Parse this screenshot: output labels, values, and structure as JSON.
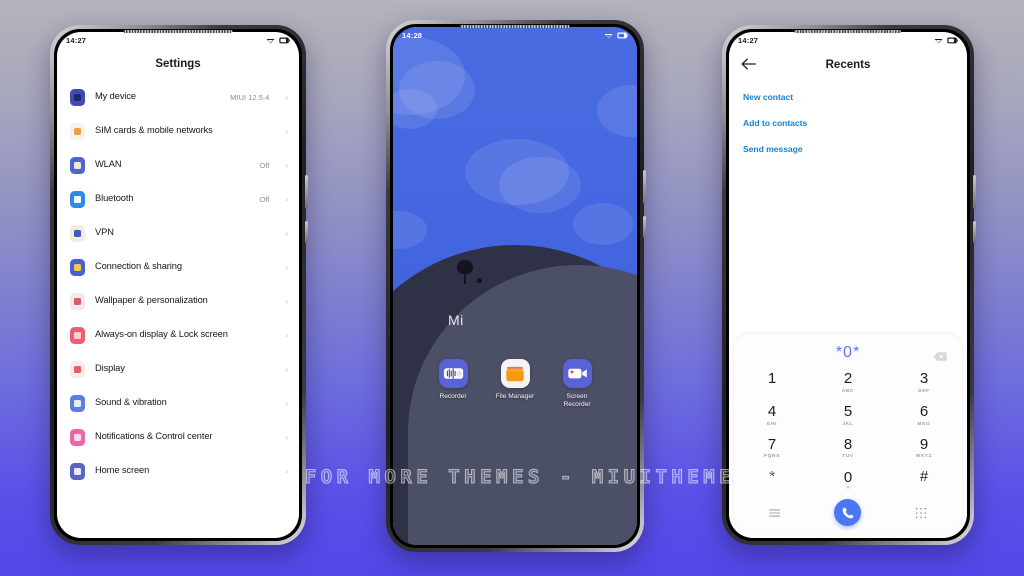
{
  "background": {
    "top_color": "#b4b4bc",
    "bottom_color": "#5347ea"
  },
  "watermark": {
    "text": "VISIT  FOR  MORE  THEMES  -  MIUITHEMER.COM"
  },
  "phone_settings": {
    "status_bar": {
      "time": "14:27",
      "wifi_icon": "wifi-icon",
      "battery_icon": "battery-icon"
    },
    "title": "Settings",
    "items": [
      {
        "label": "My device",
        "value": "MIUI 12.5.4",
        "chevron": "›",
        "icon": "device-icon",
        "icon_bg": "#3f4bb8",
        "icon_glyph": "#1b2a66"
      },
      {
        "label": "SIM cards & mobile networks",
        "value": "",
        "chevron": "›",
        "icon": "sim-card-icon",
        "icon_bg": "#f4f2ee",
        "icon_glyph": "#e8a33d"
      },
      {
        "label": "WLAN",
        "value": "Off",
        "chevron": "›",
        "icon": "wifi-settings-icon",
        "icon_bg": "#4e63d8",
        "icon_glyph": "#f2e9c6"
      },
      {
        "label": "Bluetooth",
        "value": "Off",
        "chevron": "›",
        "icon": "bluetooth-icon",
        "icon_bg": "#2e8ae6",
        "icon_glyph": "#ffffff"
      },
      {
        "label": "VPN",
        "value": "",
        "chevron": "›",
        "icon": "vpn-icon",
        "icon_bg": "#f0ece2",
        "icon_glyph": "#3f5bbf"
      },
      {
        "label": "Connection & sharing",
        "value": "",
        "chevron": "›",
        "icon": "connection-icon",
        "icon_bg": "#4a5fd6",
        "icon_glyph": "#f3c84a"
      },
      {
        "label": "Wallpaper & personalization",
        "value": "",
        "chevron": "›",
        "icon": "wallpaper-icon",
        "icon_bg": "#f2eaea",
        "icon_glyph": "#e0566f"
      },
      {
        "label": "Always-on display & Lock screen",
        "value": "",
        "chevron": "›",
        "icon": "lock-screen-icon",
        "icon_bg": "#ef5d72",
        "icon_glyph": "#ffd2d8"
      },
      {
        "label": "Display",
        "value": "",
        "chevron": "›",
        "icon": "display-icon",
        "icon_bg": "#f6ecec",
        "icon_glyph": "#ef5a5a"
      },
      {
        "label": "Sound & vibration",
        "value": "",
        "chevron": "›",
        "icon": "sound-icon",
        "icon_bg": "#5a7fe0",
        "icon_glyph": "#e7eefc"
      },
      {
        "label": "Notifications & Control center",
        "value": "",
        "chevron": "›",
        "icon": "notifications-icon",
        "icon_bg": "#e668a8",
        "icon_glyph": "#ffd9ec"
      },
      {
        "label": "Home screen",
        "value": "",
        "chevron": "›",
        "icon": "home-screen-icon",
        "icon_bg": "#5a64c2",
        "icon_glyph": "#e8eaf8"
      }
    ]
  },
  "phone_home": {
    "status_bar": {
      "time": "14:28",
      "wifi_icon": "wifi-icon",
      "battery_icon": "battery-icon"
    },
    "wallpaper_logo": "Mi",
    "apps": [
      {
        "name": "Recorder",
        "icon": "recorder-icon",
        "bg": "#5a62d8"
      },
      {
        "name": "File Manager",
        "icon": "file-manager-icon",
        "bg": "#f4f4f6"
      },
      {
        "name": "Screen Recorder",
        "icon": "screen-recorder-icon",
        "bg": "#5a62d8"
      }
    ]
  },
  "phone_dialer": {
    "status_bar": {
      "time": "14:27",
      "wifi_icon": "wifi-icon",
      "battery_icon": "battery-icon"
    },
    "back_icon": "back-arrow-icon",
    "title": "Recents",
    "actions": [
      "New contact",
      "Add to contacts",
      "Send message"
    ],
    "dialed_number": "*0*",
    "backspace_icon": "backspace-icon",
    "keys": [
      {
        "digit": "1",
        "sub": ""
      },
      {
        "digit": "2",
        "sub": "ABC"
      },
      {
        "digit": "3",
        "sub": "DEF"
      },
      {
        "digit": "4",
        "sub": "GHI"
      },
      {
        "digit": "5",
        "sub": "JKL"
      },
      {
        "digit": "6",
        "sub": "MNO"
      },
      {
        "digit": "7",
        "sub": "PQRS"
      },
      {
        "digit": "8",
        "sub": "TUV"
      },
      {
        "digit": "9",
        "sub": "WXYZ"
      },
      {
        "digit": "*",
        "sub": ""
      },
      {
        "digit": "0",
        "sub": "+"
      },
      {
        "digit": "#",
        "sub": ""
      }
    ],
    "menu_icon": "menu-icon",
    "call_icon": "call-icon",
    "keypad_icon": "keypad-icon",
    "accent_color": "#4a78f0",
    "link_color": "#1783d6"
  }
}
